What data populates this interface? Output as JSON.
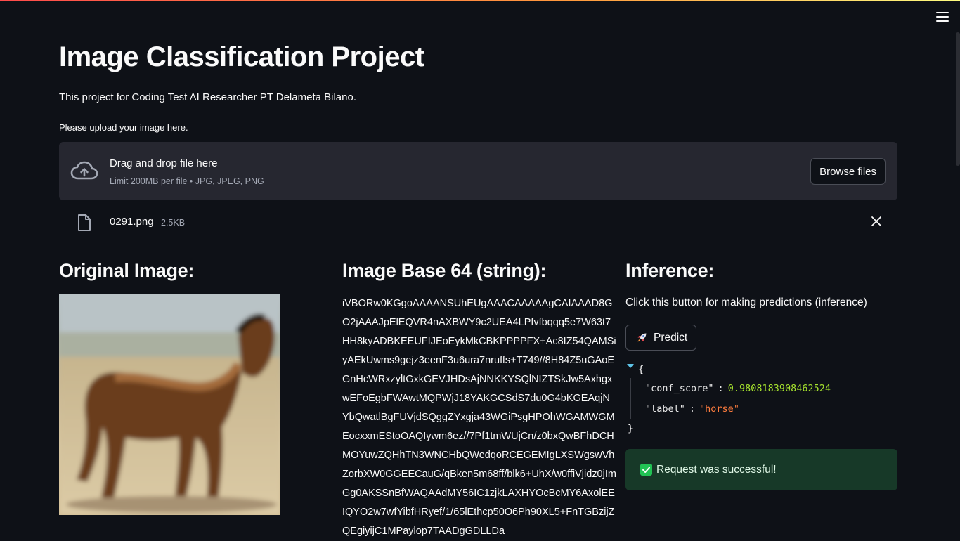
{
  "header": {
    "menu_icon": "hamburger-menu-icon",
    "title": "Image Classification Project",
    "description": "This project for Coding Test AI Researcher PT Delameta Bilano."
  },
  "uploader": {
    "label": "Please upload your image here.",
    "icon": "cloud-upload-icon",
    "drag_text": "Drag and drop file here",
    "limit_text": "Limit 200MB per file • JPG, JPEG, PNG",
    "browse_label": "Browse files",
    "file": {
      "icon": "file-icon",
      "name": "0291.png",
      "size": "2.5KB",
      "remove_icon": "close-icon"
    }
  },
  "original": {
    "heading": "Original Image:"
  },
  "base64": {
    "heading": "Image Base 64 (string):",
    "value": "iVBORw0KGgoAAAANSUhEUgAAACAAAAAgCAIAAAD8GO2jAAAJpElEQVR4nAXBWY9c2UEA4LPfvfbqqq5e7W63t7HH8kyADBKEEUFIJEoEykMkCBKPPPPFX+Ac8IZ54QAMSiyAEkUwms9gejz3eenF3u6ura7nruffs+T749//8H84Z5uGAoEGnHcWRxzyltGxkGEVJHDsAjNNKKYSQlNIZTSkJw5AxhgxwEFoEgbFWAwtMQPWjJ18YAKGCSdS7du0G4bKGEAqjNYbQwatlBgFUVjdSQggZYxgja43WGiPsgHPOhWGAMWGMEocxxmEStoOAQIywm6ez//7Pf1tmWUjCn/z0bxQwBFhDCHMOYuwZQHhTN3WNCHbQWedqoRCEGEMIgLXSWgswVhZorbXW0GGEECauG/qBken5m68ff/blk6+UhX/w0ffiVjidz0jImGg0AKSSnBfWAQAAdMY56IC1zjkLAXHYOcBcMY6AxolEEIQYO2w7wfYibfHRyef/1/65lEthcp50O6Ph90XL5+FnTGBzijZQEgiyijC1MPaylop7TAADgGDLLDa"
  },
  "inference": {
    "heading": "Inference:",
    "instruction": "Click this button for making predictions (inference)",
    "predict_icon": "rocket-icon",
    "predict_label": "Predict",
    "result": {
      "expand_icon": "collapse-arrow-icon",
      "open": "{",
      "close": "}",
      "conf_key": "\"conf_score\"",
      "conf_value": "0.9808183908462524",
      "label_key": "\"label\"",
      "label_value": "\"horse\""
    },
    "status_icon": "check-icon",
    "status": "Request was successful!"
  },
  "colors": {
    "background": "#0e1117",
    "panel": "#262730",
    "success_bg": "#173928",
    "accent_green": "#21c354"
  }
}
